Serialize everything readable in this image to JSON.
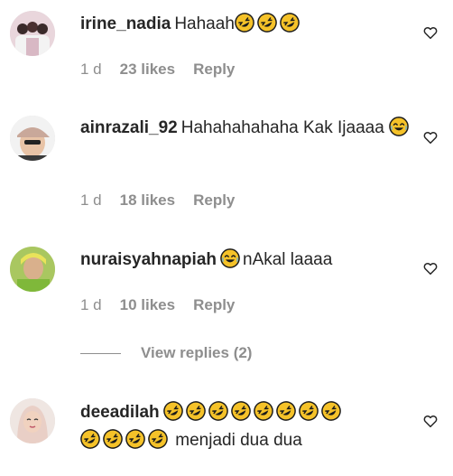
{
  "comments": [
    {
      "username": "irine_nadia",
      "text_before": "Hahaah",
      "emoji_count": 3,
      "text_after": "",
      "time": "1 d",
      "likes": "23 likes",
      "reply": "Reply",
      "avatar_icon": "group-photo-avatar"
    },
    {
      "username": "ainrazali_92",
      "text_before": "Hahahahahaha Kak Ijaaaa",
      "emoji_count": 1,
      "emoji_type": "joy",
      "text_after": "",
      "time": "1 d",
      "likes": "18 likes",
      "reply": "Reply",
      "avatar_icon": "cap-person-avatar"
    },
    {
      "username": "nuraisyahnapiah",
      "text_before": "",
      "emoji_count": 1,
      "emoji_type": "joy",
      "text_after": "nAkal laaaa",
      "time": "1 d",
      "likes": "10 likes",
      "reply": "Reply",
      "avatar_icon": "green-outfit-avatar"
    },
    {
      "username": "deeadilah",
      "emoji_count_line1": 8,
      "emoji_count_line2": 4,
      "text_after": "menjadi dua dua",
      "avatar_icon": "hijab-avatar"
    }
  ],
  "view_replies": "View replies (2)",
  "icons": {
    "like": "heart-outline-icon",
    "emoji_rofl": "rolling-on-floor-laughing-emoji",
    "emoji_joy": "tears-of-joy-emoji"
  },
  "colors": {
    "text": "#262626",
    "muted": "#8e8e8e",
    "emoji": "#f5c229"
  }
}
